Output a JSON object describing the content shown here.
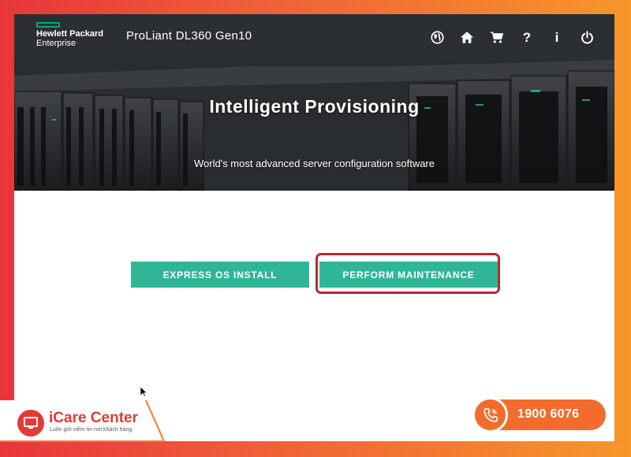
{
  "header": {
    "logo_line1": "Hewlett Packard",
    "logo_line2": "Enterprise",
    "product": "ProLiant DL360 Gen10",
    "icons": [
      "globe-icon",
      "home-icon",
      "cart-icon",
      "help-icon",
      "info-icon",
      "power-icon"
    ],
    "help_glyph": "?",
    "info_glyph": "i"
  },
  "hero": {
    "title": "Intelligent Provisioning",
    "subtitle": "World's most advanced server configuration software"
  },
  "actions": {
    "express_label": "EXPRESS OS INSTALL",
    "maintenance_label": "PERFORM MAINTENANCE"
  },
  "branding": {
    "name": "iCare Center",
    "tagline": "Luôn gửi niềm tin nơi khách hàng",
    "hotline": "1900 6076"
  },
  "colors": {
    "accent": "#2fb697",
    "highlight": "#b9282e",
    "hpe_green": "#01a982",
    "frame_start": "#e8353b",
    "frame_end": "#f7962a"
  }
}
